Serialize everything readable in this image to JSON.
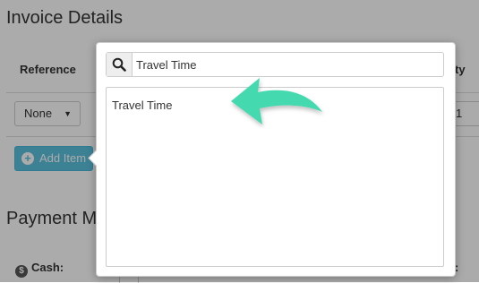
{
  "background": {
    "title": "Invoice Details",
    "columns": {
      "reference": "Reference",
      "quantity_fragment": "ty"
    },
    "reference_select": {
      "value": "None"
    },
    "quantity_value": "1",
    "add_item_label": "Add Item",
    "payment_title": "Payment M",
    "cash_label": "Cash:",
    "right_label_fragment": ":"
  },
  "popover": {
    "search": {
      "value": "Travel Time",
      "icon": "search-icon"
    },
    "results": [
      {
        "label": "Travel Time"
      }
    ]
  },
  "annotation": {
    "icon": "curved-arrow-icon",
    "color": "#45d9b0"
  },
  "colors": {
    "overlay": "rgba(0,0,0,0.33)",
    "add_button": "#5bc0de",
    "border": "#cccccc"
  }
}
